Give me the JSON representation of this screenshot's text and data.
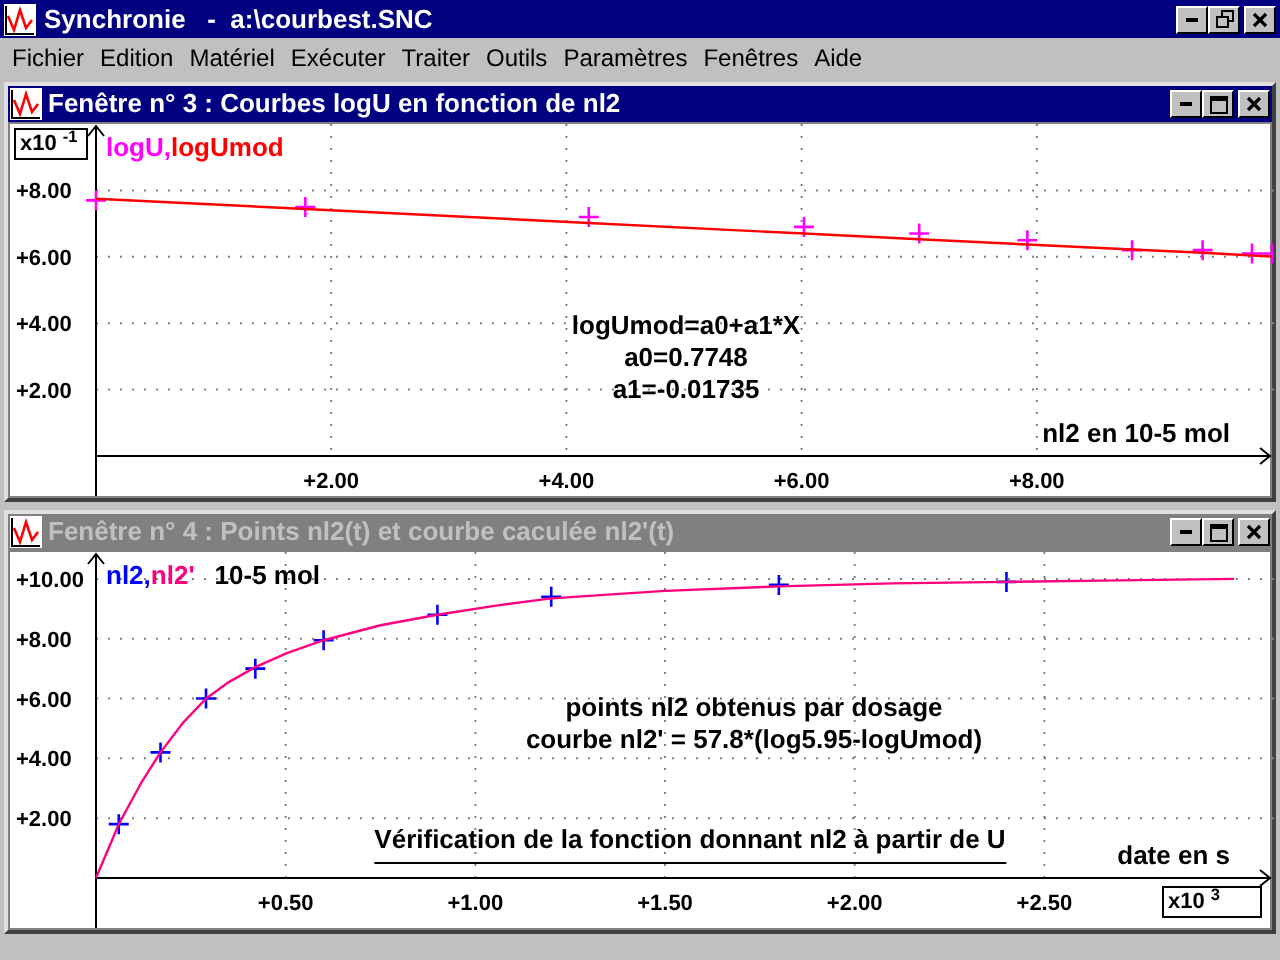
{
  "app": {
    "title": "Synchronie   -  a:\\courbest.SNC"
  },
  "menu": [
    {
      "label": "Fichier"
    },
    {
      "label": "Edition"
    },
    {
      "label": "Matériel"
    },
    {
      "label": "Exécuter"
    },
    {
      "label": "Traiter"
    },
    {
      "label": "Outils"
    },
    {
      "label": "Paramètres"
    },
    {
      "label": "Fenêtres"
    },
    {
      "label": "Aide"
    }
  ],
  "windows": [
    {
      "title": "Fenêtre n° 3 : Courbes logU en fonction de nl2",
      "active": true,
      "legend": [
        {
          "text": "logU,",
          "color": "#ff00ff"
        },
        {
          "text": "logUmod",
          "color": "#ff0000"
        }
      ],
      "multiplier": {
        "text": "x10 $^{-1}$",
        "kind": "y"
      },
      "notes": [
        {
          "kind": "plain",
          "lines": [
            "logUmod=a0+a1*X",
            "a0=0.7748",
            "a1=-0.01735"
          ]
        }
      ],
      "chart_data": {
        "type": "line",
        "grid": true,
        "xlabel": "nl2 en 10-5 mol",
        "x": [
          0,
          1.78,
          4.19,
          6.02,
          7.0,
          7.92,
          8.81,
          9.41,
          9.83,
          10
        ],
        "series": [
          {
            "type": "scatter",
            "marker": "+",
            "color": "#ff00ff",
            "values": [
              7.7,
              7.5,
              7.2,
              6.9,
              6.7,
              6.5,
              6.2,
              6.2,
              6.1,
              6.1
            ]
          },
          {
            "type": "line",
            "color": "#ff0000",
            "values": [
              7.75,
              7.44,
              7.02,
              6.7,
              6.53,
              6.37,
              6.22,
              6.12,
              6.04,
              6.01
            ]
          }
        ],
        "xlim": [
          0,
          10
        ],
        "ylim": [
          0,
          10
        ],
        "xticks": [
          {
            "value": 2,
            "label": "+2.00"
          },
          {
            "value": 4,
            "label": "+4.00"
          },
          {
            "value": 6,
            "label": "+6.00"
          },
          {
            "value": 8,
            "label": "+8.00"
          }
        ],
        "yticks": [
          {
            "value": 2,
            "label": "+2.00"
          },
          {
            "value": 4,
            "label": "+4.00"
          },
          {
            "value": 6,
            "label": "+6.00"
          },
          {
            "value": 8,
            "label": "+8.00"
          }
        ]
      }
    },
    {
      "title": "Fenêtre n° 4 : Points nl2(t) et courbe caculée nl2'(t)",
      "active": false,
      "legend": [
        {
          "text": "nl2,",
          "color": "#0000ff"
        },
        {
          "text": "nl2'",
          "color": "#ff0080"
        }
      ],
      "unit": "10-5 mol",
      "multiplier": {
        "text": "x10 $^{3}$",
        "kind": "x"
      },
      "notes": [
        {
          "kind": "plain",
          "lines": [
            "points nl2 obtenus par dosage",
            "courbe nl2' = 57.8*(log5.95-logUmod)"
          ]
        },
        {
          "kind": "underlined",
          "lines": [
            "Vérification de la fonction donnant nl2 à partir de U"
          ]
        }
      ],
      "chart_data": {
        "type": "line",
        "grid": true,
        "xlabel": "date en s",
        "x": [
          0,
          0.06,
          0.12,
          0.17,
          0.23,
          0.29,
          0.35,
          0.42,
          0.5,
          0.6,
          0.75,
          0.9,
          1.05,
          1.2,
          1.5,
          1.8,
          2.1,
          2.4,
          2.7,
          3.0
        ],
        "series": [
          {
            "type": "scatter",
            "marker": "+",
            "color": "#0000ff",
            "values": [
              null,
              1.8,
              null,
              4.2,
              null,
              6.0,
              null,
              7.0,
              null,
              7.95,
              null,
              8.8,
              null,
              9.4,
              null,
              9.8,
              null,
              9.9,
              null,
              null
            ]
          },
          {
            "type": "line",
            "color": "#ff0080",
            "values": [
              0,
              1.8,
              3.2,
              4.2,
              5.2,
              6.0,
              6.55,
              7.05,
              7.5,
              7.95,
              8.45,
              8.8,
              9.1,
              9.35,
              9.6,
              9.75,
              9.85,
              9.9,
              9.95,
              10.0
            ]
          }
        ],
        "xlim": [
          0,
          3.1
        ],
        "ylim": [
          0,
          10.9
        ],
        "xticks": [
          {
            "value": 0.5,
            "label": "+0.50"
          },
          {
            "value": 1,
            "label": "+1.00"
          },
          {
            "value": 1.5,
            "label": "+1.50"
          },
          {
            "value": 2,
            "label": "+2.00"
          },
          {
            "value": 2.5,
            "label": "+2.50"
          }
        ],
        "yticks": [
          {
            "value": 2,
            "label": "+2.00"
          },
          {
            "value": 4,
            "label": "+4.00"
          },
          {
            "value": 6,
            "label": "+6.00"
          },
          {
            "value": 8,
            "label": "+8.00"
          },
          {
            "value": 10,
            "label": "+10.00"
          }
        ]
      }
    }
  ]
}
